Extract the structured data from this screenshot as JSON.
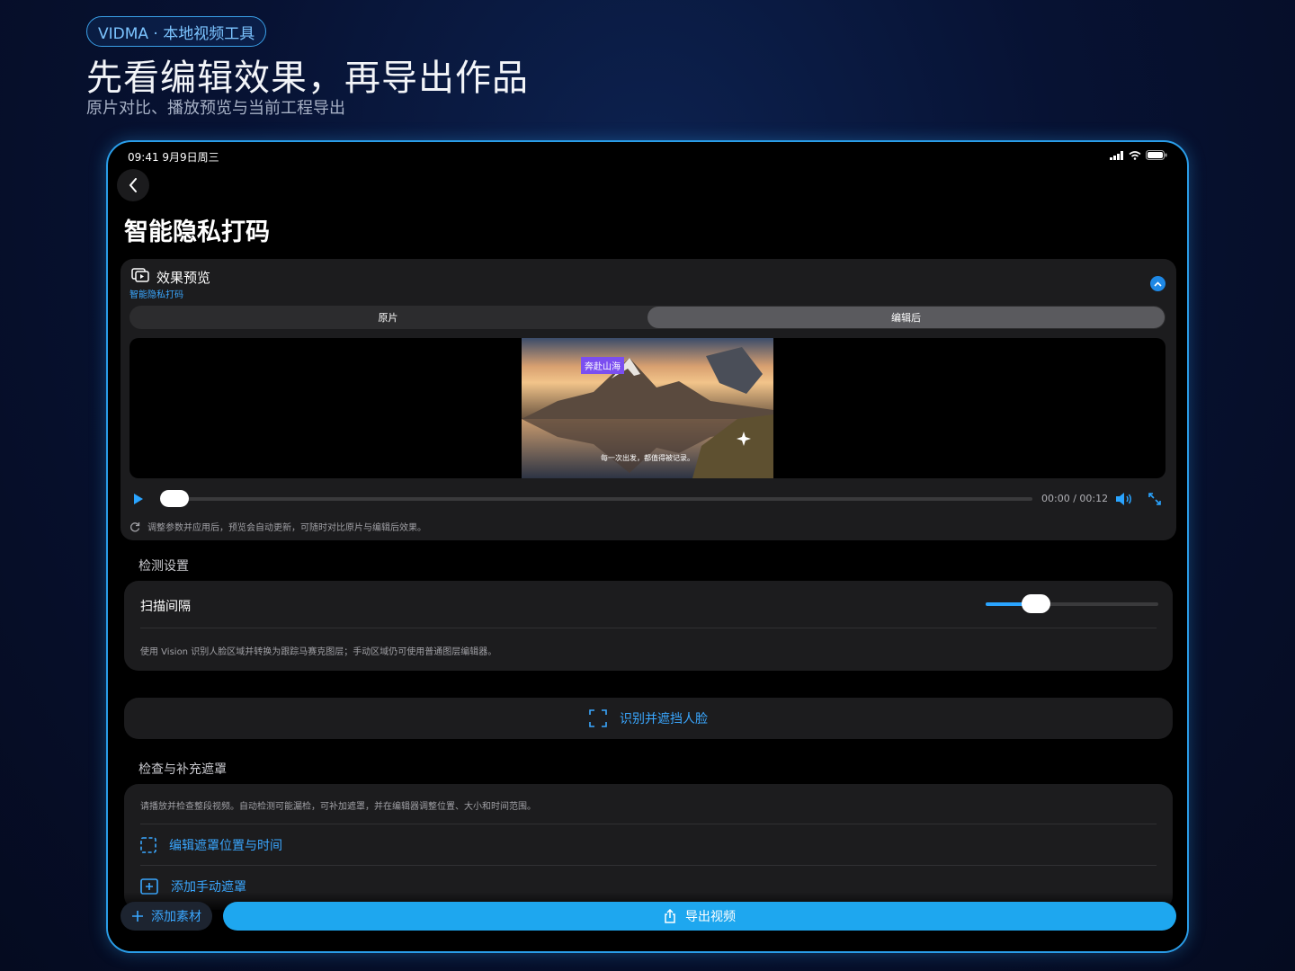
{
  "promo": {
    "badge": "VIDMA · 本地视频工具",
    "headline": "先看编辑效果，再导出作品",
    "subline": "原片对比、播放预览与当前工程导出"
  },
  "status_bar": {
    "time": "09:41  9月9日周三"
  },
  "page": {
    "title": "智能隐私打码"
  },
  "preview_card": {
    "title": "效果预览",
    "subtitle": "智能隐私打码",
    "segments": [
      "原片",
      "编辑后"
    ],
    "selected_segment": "编辑后",
    "video": {
      "title_chip": "奔赴山海",
      "caption": "每一次出发，都值得被记录。"
    },
    "player": {
      "time": "00:00 / 00:12",
      "progress": 0.0
    },
    "hint": "调整参数并应用后，预览会自动更新，可随时对比原片与编辑后效果。"
  },
  "detection": {
    "section_label": "检测设置",
    "scan_label": "扫描间隔",
    "scan_slider_value": 0.29,
    "description": "使用 Vision 识别人脸区域并转换为跟踪马赛克图层；手动区域仍可使用普通图层编辑器。"
  },
  "detect_button": {
    "label": "识别并遮挡人脸"
  },
  "review": {
    "section_label": "检查与补充遮罩",
    "description": "请播放并检查整段视频。自动检测可能漏检，可补加遮罩，并在编辑器调整位置、大小和时间范围。",
    "edit_mask_label": "编辑遮罩位置与时间",
    "add_mask_label": "添加手动遮罩"
  },
  "bottom": {
    "add_label": "添加素材",
    "export_label": "导出视频"
  },
  "colors": {
    "accent": "#1ea7ef",
    "link": "#3aa7ff",
    "card": "#1c1c1e",
    "tag": "#7b4ff0"
  }
}
